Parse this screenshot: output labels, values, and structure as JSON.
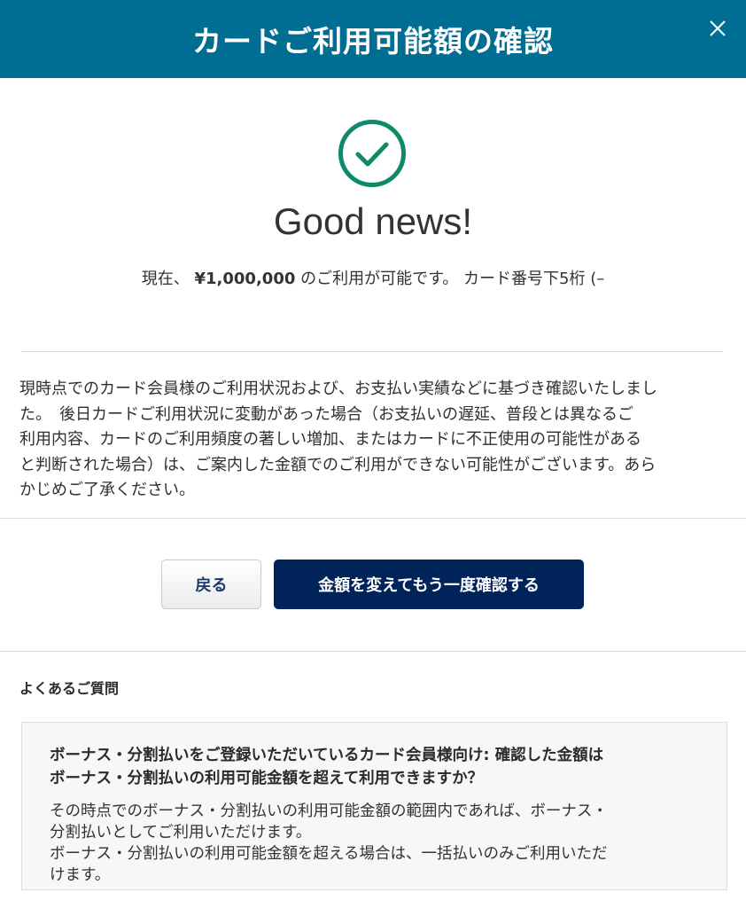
{
  "header": {
    "title": "カードご利用可能額の確認",
    "close_icon": "close-icon",
    "background_color": "#006e92"
  },
  "result": {
    "icon": "check-circle-icon",
    "icon_color": "#0e8a6a",
    "headline": "Good news!",
    "summary_prefix": "現在、",
    "amount": "¥1,000,000",
    "summary_suffix": "のご利用が可能です。 カード番号下5桁 (–"
  },
  "notice": {
    "lines": [
      "現時点でのカード会員様のご利用状況および、お支払い実績などに基づき確認いたしまし",
      "た。　後日カードご利用状況に変動があった場合（お支払いの遅延、普段とは異なるご",
      "利用内容、カードのご利用頻度の著しい増加、またはカードに不正使用の可能性がある",
      "と判断された場合）は、ご案内した金額でのご利用ができない可能性がございます。あら",
      "かじめご了承ください。"
    ]
  },
  "actions": {
    "back_label": "戻る",
    "recheck_label": "金額を変えてもう一度確認する",
    "primary_color": "#00235a"
  },
  "faq": {
    "heading": "よくあるご質問",
    "items": [
      {
        "question_lines": [
          "ボーナス・分割払いをご登録いただいているカード会員様向け: 確認した金額は",
          "ボーナス・分割払いの利用可能金額を超えて利用できますか？"
        ],
        "answer_lines": [
          "その時点でのボーナス・分割払いの利用可能金額の範囲内であれば、ボーナス・",
          "分割払いとしてご利用いただけます。",
          "ボーナス・分割払いの利用可能金額を超える場合は、一括払いのみご利用いただ",
          "けます。"
        ]
      }
    ]
  }
}
